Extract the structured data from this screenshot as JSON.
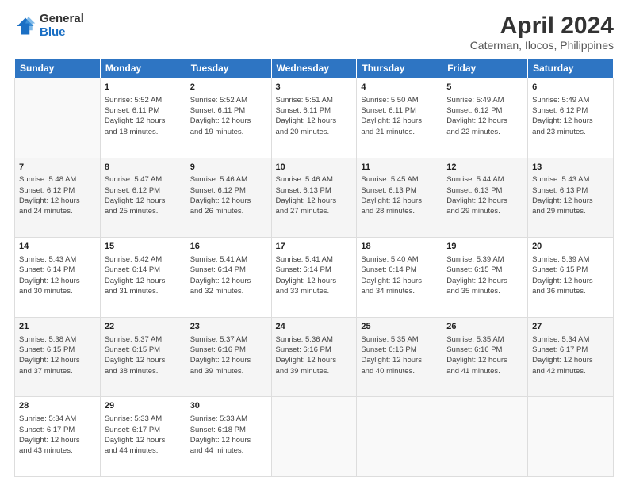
{
  "header": {
    "logo_general": "General",
    "logo_blue": "Blue",
    "title": "April 2024",
    "subtitle": "Caterman, Ilocos, Philippines"
  },
  "weekdays": [
    "Sunday",
    "Monday",
    "Tuesday",
    "Wednesday",
    "Thursday",
    "Friday",
    "Saturday"
  ],
  "weeks": [
    [
      {
        "day": "",
        "info": ""
      },
      {
        "day": "1",
        "info": "Sunrise: 5:52 AM\nSunset: 6:11 PM\nDaylight: 12 hours\nand 18 minutes."
      },
      {
        "day": "2",
        "info": "Sunrise: 5:52 AM\nSunset: 6:11 PM\nDaylight: 12 hours\nand 19 minutes."
      },
      {
        "day": "3",
        "info": "Sunrise: 5:51 AM\nSunset: 6:11 PM\nDaylight: 12 hours\nand 20 minutes."
      },
      {
        "day": "4",
        "info": "Sunrise: 5:50 AM\nSunset: 6:11 PM\nDaylight: 12 hours\nand 21 minutes."
      },
      {
        "day": "5",
        "info": "Sunrise: 5:49 AM\nSunset: 6:12 PM\nDaylight: 12 hours\nand 22 minutes."
      },
      {
        "day": "6",
        "info": "Sunrise: 5:49 AM\nSunset: 6:12 PM\nDaylight: 12 hours\nand 23 minutes."
      }
    ],
    [
      {
        "day": "7",
        "info": "Sunrise: 5:48 AM\nSunset: 6:12 PM\nDaylight: 12 hours\nand 24 minutes."
      },
      {
        "day": "8",
        "info": "Sunrise: 5:47 AM\nSunset: 6:12 PM\nDaylight: 12 hours\nand 25 minutes."
      },
      {
        "day": "9",
        "info": "Sunrise: 5:46 AM\nSunset: 6:12 PM\nDaylight: 12 hours\nand 26 minutes."
      },
      {
        "day": "10",
        "info": "Sunrise: 5:46 AM\nSunset: 6:13 PM\nDaylight: 12 hours\nand 27 minutes."
      },
      {
        "day": "11",
        "info": "Sunrise: 5:45 AM\nSunset: 6:13 PM\nDaylight: 12 hours\nand 28 minutes."
      },
      {
        "day": "12",
        "info": "Sunrise: 5:44 AM\nSunset: 6:13 PM\nDaylight: 12 hours\nand 29 minutes."
      },
      {
        "day": "13",
        "info": "Sunrise: 5:43 AM\nSunset: 6:13 PM\nDaylight: 12 hours\nand 29 minutes."
      }
    ],
    [
      {
        "day": "14",
        "info": "Sunrise: 5:43 AM\nSunset: 6:14 PM\nDaylight: 12 hours\nand 30 minutes."
      },
      {
        "day": "15",
        "info": "Sunrise: 5:42 AM\nSunset: 6:14 PM\nDaylight: 12 hours\nand 31 minutes."
      },
      {
        "day": "16",
        "info": "Sunrise: 5:41 AM\nSunset: 6:14 PM\nDaylight: 12 hours\nand 32 minutes."
      },
      {
        "day": "17",
        "info": "Sunrise: 5:41 AM\nSunset: 6:14 PM\nDaylight: 12 hours\nand 33 minutes."
      },
      {
        "day": "18",
        "info": "Sunrise: 5:40 AM\nSunset: 6:14 PM\nDaylight: 12 hours\nand 34 minutes."
      },
      {
        "day": "19",
        "info": "Sunrise: 5:39 AM\nSunset: 6:15 PM\nDaylight: 12 hours\nand 35 minutes."
      },
      {
        "day": "20",
        "info": "Sunrise: 5:39 AM\nSunset: 6:15 PM\nDaylight: 12 hours\nand 36 minutes."
      }
    ],
    [
      {
        "day": "21",
        "info": "Sunrise: 5:38 AM\nSunset: 6:15 PM\nDaylight: 12 hours\nand 37 minutes."
      },
      {
        "day": "22",
        "info": "Sunrise: 5:37 AM\nSunset: 6:15 PM\nDaylight: 12 hours\nand 38 minutes."
      },
      {
        "day": "23",
        "info": "Sunrise: 5:37 AM\nSunset: 6:16 PM\nDaylight: 12 hours\nand 39 minutes."
      },
      {
        "day": "24",
        "info": "Sunrise: 5:36 AM\nSunset: 6:16 PM\nDaylight: 12 hours\nand 39 minutes."
      },
      {
        "day": "25",
        "info": "Sunrise: 5:35 AM\nSunset: 6:16 PM\nDaylight: 12 hours\nand 40 minutes."
      },
      {
        "day": "26",
        "info": "Sunrise: 5:35 AM\nSunset: 6:16 PM\nDaylight: 12 hours\nand 41 minutes."
      },
      {
        "day": "27",
        "info": "Sunrise: 5:34 AM\nSunset: 6:17 PM\nDaylight: 12 hours\nand 42 minutes."
      }
    ],
    [
      {
        "day": "28",
        "info": "Sunrise: 5:34 AM\nSunset: 6:17 PM\nDaylight: 12 hours\nand 43 minutes."
      },
      {
        "day": "29",
        "info": "Sunrise: 5:33 AM\nSunset: 6:17 PM\nDaylight: 12 hours\nand 44 minutes."
      },
      {
        "day": "30",
        "info": "Sunrise: 5:33 AM\nSunset: 6:18 PM\nDaylight: 12 hours\nand 44 minutes."
      },
      {
        "day": "",
        "info": ""
      },
      {
        "day": "",
        "info": ""
      },
      {
        "day": "",
        "info": ""
      },
      {
        "day": "",
        "info": ""
      }
    ]
  ]
}
